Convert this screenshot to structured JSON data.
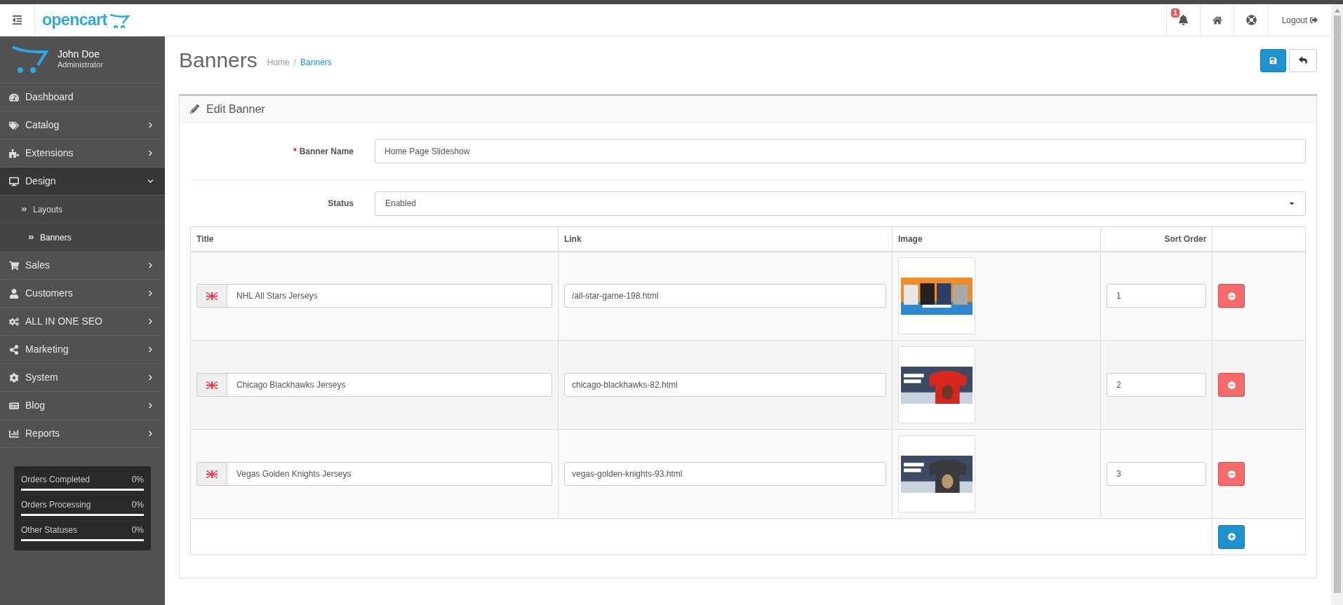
{
  "header": {
    "logo": "opencart",
    "notifications": {
      "count": "1"
    },
    "logout": "Logout"
  },
  "user": {
    "name": "John Doe",
    "role": "Administrator"
  },
  "sidebar": {
    "items": [
      {
        "label": "Dashboard",
        "kind": "link",
        "expanded": false
      },
      {
        "label": "Catalog",
        "kind": "menu",
        "expanded": false
      },
      {
        "label": "Extensions",
        "kind": "menu",
        "expanded": false
      },
      {
        "label": "Design",
        "kind": "menu",
        "expanded": true,
        "children": [
          {
            "label": "Layouts",
            "selected": false
          },
          {
            "label": "Banners",
            "selected": true
          }
        ]
      },
      {
        "label": "Sales",
        "kind": "menu",
        "expanded": false
      },
      {
        "label": "Customers",
        "kind": "menu",
        "expanded": false
      },
      {
        "label": "ALL IN ONE SEO",
        "kind": "menu",
        "expanded": false
      },
      {
        "label": "Marketing",
        "kind": "menu",
        "expanded": false
      },
      {
        "label": "System",
        "kind": "menu",
        "expanded": false
      },
      {
        "label": "Blog",
        "kind": "menu",
        "expanded": false
      },
      {
        "label": "Reports",
        "kind": "menu",
        "expanded": false
      }
    ],
    "stats": [
      {
        "label": "Orders Completed",
        "reading": "0%",
        "level": 0
      },
      {
        "label": "Orders Processing",
        "reading": "0%",
        "level": 0
      },
      {
        "label": "Other Statuses",
        "reading": "0%",
        "level": 0
      }
    ]
  },
  "page": {
    "title": "Banners",
    "breadcrumb_separator": "/",
    "breadcrumb": [
      {
        "label": "Home",
        "selected": false
      },
      {
        "label": "Banners",
        "selected": true
      }
    ]
  },
  "panel": {
    "title": "Edit Banner",
    "required_mark": "*",
    "fields": [
      {
        "label": "Banner Name",
        "required": true,
        "kind": "text",
        "value": "Home Page Slideshow"
      },
      {
        "label": "Status",
        "required": false,
        "kind": "select",
        "value": "Enabled"
      }
    ],
    "table": {
      "columns": [
        "Title",
        "Link",
        "Image",
        "Sort Order"
      ],
      "rows": [
        {
          "title": "NHL All Stars Jerseys",
          "link": "/all-star-game-198.html",
          "sort_order": "1"
        },
        {
          "title": "Chicago Blackhawks Jerseys",
          "link": "chicago-blackhawks-82.html",
          "sort_order": "2"
        },
        {
          "title": "Vegas Golden Knights Jerseys",
          "link": "vegas-golden-knights-93.html",
          "sort_order": "3"
        }
      ]
    }
  }
}
